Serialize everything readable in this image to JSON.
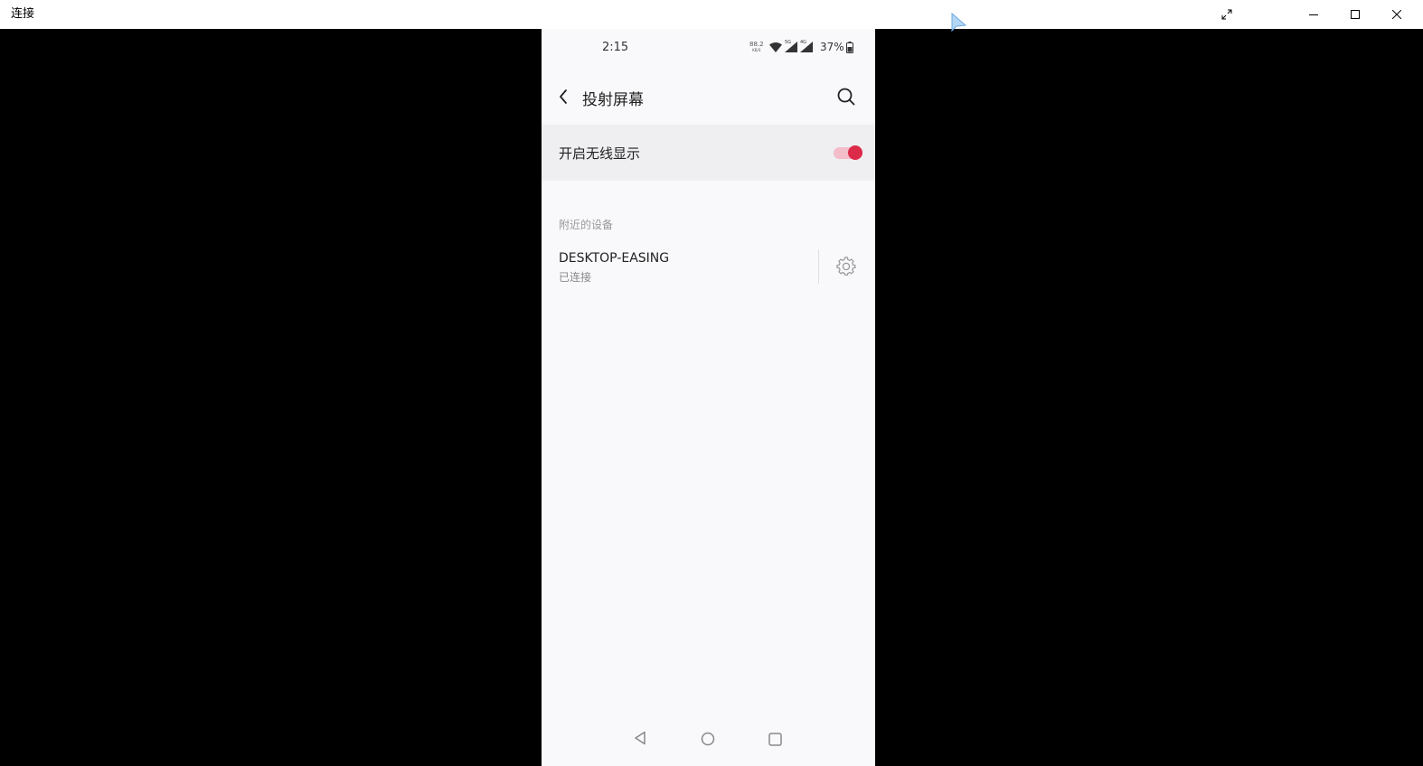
{
  "window": {
    "title": "连接"
  },
  "phone": {
    "status_bar": {
      "time": "2:15",
      "net_speed": "88.2",
      "net_speed_unit": "KB/S",
      "network_5g": "5G",
      "network_4g": "4G",
      "battery": "37%"
    },
    "header": {
      "title": "投射屏幕"
    },
    "wireless_display": {
      "label": "开启无线显示",
      "enabled": true
    },
    "nearby_devices": {
      "section_label": "附近的设备",
      "devices": [
        {
          "name": "DESKTOP-EASING",
          "status": "已连接"
        }
      ]
    }
  },
  "colors": {
    "accent": "#dc2a49",
    "toggle_track": "#f3bdc9",
    "phone_bg": "#f9f8fb"
  },
  "icons": {
    "back": "back-arrow-icon",
    "search": "search-icon",
    "settings": "gear-icon",
    "wifi": "wifi-icon",
    "signal": "signal-icon",
    "battery": "battery-icon",
    "nav_back": "triangle-back-icon",
    "nav_home": "circle-home-icon",
    "nav_recent": "square-recent-icon"
  }
}
